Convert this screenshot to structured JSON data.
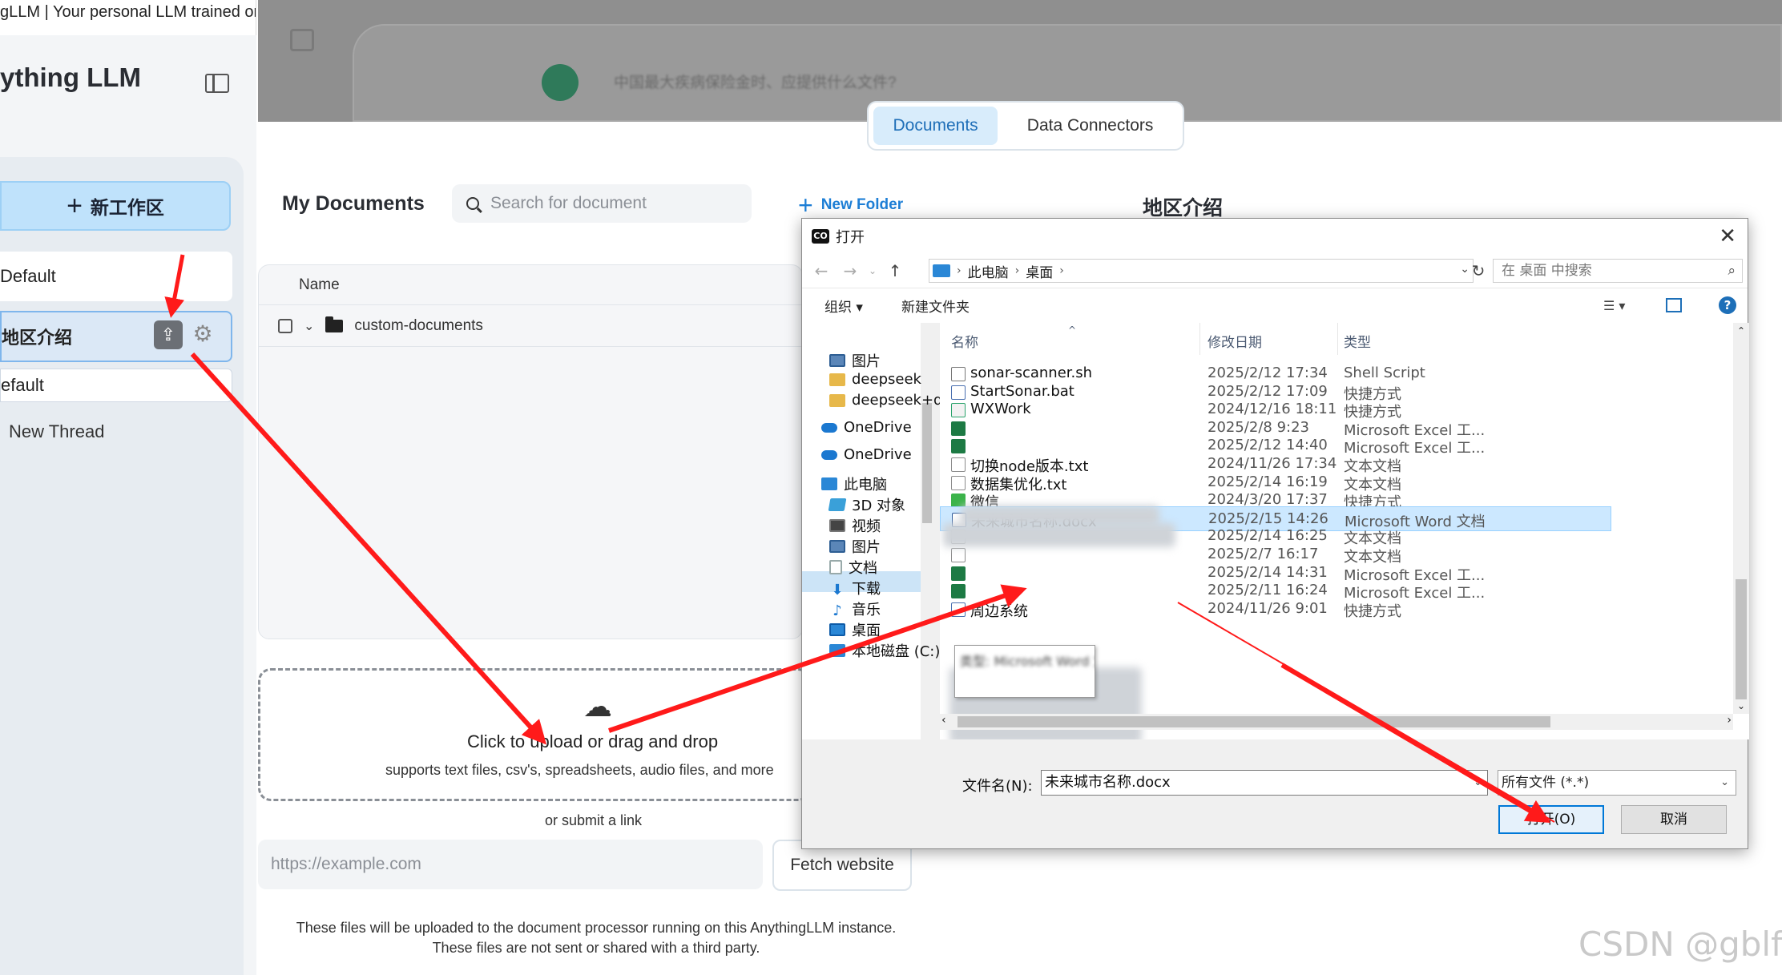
{
  "browser_tab": {
    "title": "gLLM | Your personal LLM trained on"
  },
  "sidebar": {
    "brand": "ything LLM",
    "new_workspace": "新工作区",
    "workspaces": [
      {
        "label": "Default"
      },
      {
        "label": "地区介绍"
      }
    ],
    "threads": [
      {
        "label": "efault"
      },
      {
        "label": "New Thread"
      }
    ]
  },
  "background_chat": {
    "message_preview": "中国最大疾病保险金时、应提供什么文件?"
  },
  "modal": {
    "tabs": [
      {
        "label": "Documents",
        "active": true
      },
      {
        "label": "Data Connectors",
        "active": false
      }
    ],
    "my_documents": "My Documents",
    "search_placeholder": "Search for document",
    "new_folder": "New Folder",
    "workspace_title": "地区介绍",
    "table": {
      "header_name": "Name",
      "rows": [
        {
          "name": "custom-documents"
        }
      ]
    },
    "upload": {
      "title": "Click to upload or drag and drop",
      "subtitle": "supports text files, csv's, spreadsheets, audio files, and more"
    },
    "or_submit_link": "or submit a link",
    "url_placeholder": "https://example.com",
    "fetch_button": "Fetch website",
    "footnote_line1": "These files will be uploaded to the document processor running on this AnythingLLM instance.",
    "footnote_line2": "These files are not sent or shared with a third party."
  },
  "dialog": {
    "title": "打开",
    "logo_text": "CO",
    "breadcrumb": [
      "此电脑",
      "桌面"
    ],
    "search_placeholder": "在 桌面 中搜索",
    "toolbar": {
      "organize": "组织 ▾",
      "new_folder": "新建文件夹"
    },
    "nav_items": [
      {
        "label": "图片",
        "icon": "pictures-icon"
      },
      {
        "label": "deepseek",
        "icon": "folder-icon"
      },
      {
        "label": "deepseek+dify",
        "icon": "folder-icon"
      },
      {
        "label": "OneDrive",
        "icon": "onedrive-icon"
      },
      {
        "label": "OneDrive",
        "icon": "onedrive-icon"
      },
      {
        "label": "此电脑",
        "icon": "computer-icon"
      },
      {
        "label": "3D 对象",
        "icon": "3d-objects-icon"
      },
      {
        "label": "视频",
        "icon": "videos-icon"
      },
      {
        "label": "图片",
        "icon": "pictures-icon"
      },
      {
        "label": "文档",
        "icon": "documents-icon"
      },
      {
        "label": "下载",
        "icon": "downloads-icon"
      },
      {
        "label": "音乐",
        "icon": "music-icon"
      },
      {
        "label": "桌面",
        "icon": "desktop-icon",
        "selected": true
      },
      {
        "label": "本地磁盘 (C:)",
        "icon": "drive-icon"
      }
    ],
    "columns": {
      "name": "名称",
      "date": "修改日期",
      "type": "类型"
    },
    "files": [
      {
        "name": "sonar-scanner.sh",
        "date": "2025/2/12 17:34",
        "type": "Shell Script",
        "icon": "script-icon"
      },
      {
        "name": "StartSonar.bat",
        "date": "2025/2/12 17:09",
        "type": "快捷方式",
        "icon": "shortcut-icon"
      },
      {
        "name": "WXWork",
        "date": "2024/12/16 18:11",
        "type": "快捷方式",
        "icon": "wxwork-icon"
      },
      {
        "name": "",
        "date": "2025/2/8 9:23",
        "type": "Microsoft Excel 工...",
        "icon": "excel-icon",
        "blurred": true
      },
      {
        "name": "",
        "date": "2025/2/12 14:40",
        "type": "Microsoft Excel 工...",
        "icon": "excel-icon",
        "blurred": true
      },
      {
        "name": "切换node版本.txt",
        "date": "2024/11/26 17:34",
        "type": "文本文档",
        "icon": "text-file-icon"
      },
      {
        "name": "数据集优化.txt",
        "date": "2025/2/14 16:19",
        "type": "文本文档",
        "icon": "text-file-icon"
      },
      {
        "name": "微信",
        "date": "2024/3/20 17:37",
        "type": "快捷方式",
        "icon": "wechat-icon"
      },
      {
        "name": "未来城市名称.docx",
        "date": "2025/2/15 14:26",
        "type": "Microsoft Word 文档",
        "icon": "word-icon",
        "selected": true
      },
      {
        "name": "",
        "date": "2025/2/14 16:25",
        "type": "文本文档",
        "icon": "text-file-icon",
        "blurred": true
      },
      {
        "name": "",
        "date": "2025/2/7 16:17",
        "type": "文本文档",
        "icon": "text-file-icon",
        "blurred": true
      },
      {
        "name": "",
        "date": "2025/2/14 14:31",
        "type": "Microsoft Excel 工...",
        "icon": "excel-icon",
        "blurred": true
      },
      {
        "name": "",
        "date": "2025/2/11 16:24",
        "type": "Microsoft Excel 工...",
        "icon": "excel-icon",
        "blurred": true
      },
      {
        "name": "周边系统",
        "date": "2024/11/26 9:01",
        "type": "快捷方式",
        "icon": "shortcut-icon"
      }
    ],
    "tooltip_blurred": "类型: Microsoft Word 文档",
    "filename_label": "文件名(N):",
    "filename_value": "未来城市名称.docx",
    "filetype_value": "所有文件 (*.*)",
    "open_button": "打开(O)",
    "cancel_button": "取消"
  },
  "annotation_color": "#ff1a1a",
  "watermark": "CSDN @gblfy"
}
